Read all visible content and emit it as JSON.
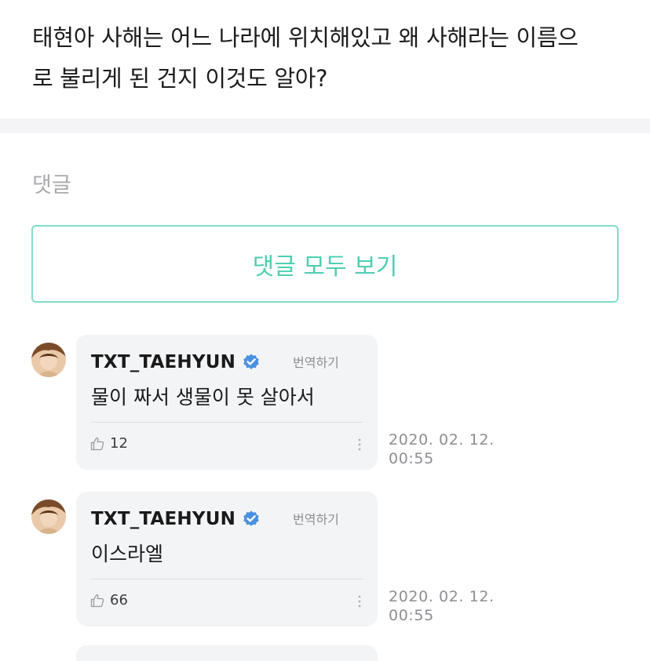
{
  "post": {
    "text_line1": "태현아 사해는 어느 나라에 위치해있고 왜 사해라는 이름으",
    "text_line2": "로 불리게 된 건지 이것도 알아?"
  },
  "comments_section": {
    "heading": "댓글",
    "view_all_label": "댓글 모두 보기"
  },
  "comments": [
    {
      "author": "TXT_TAEHYUN",
      "translate_label": "번역하기",
      "text": "물이 짜서 생물이 못 살아서",
      "likes": "12",
      "date": "2020. 02. 12.",
      "time": "00:55"
    },
    {
      "author": "TXT_TAEHYUN",
      "translate_label": "번역하기",
      "text": "이스라엘",
      "likes": "66",
      "date": "2020. 02. 12.",
      "time": "00:55"
    }
  ],
  "icons": {
    "verified": "verified-badge-icon",
    "like": "thumbs-up-icon",
    "more": "more-vertical-icon"
  },
  "colors": {
    "accent": "#4fcfb2",
    "accent_border": "#7fddc9",
    "bubble_bg": "#f3f4f6",
    "verified_blue": "#4a90e2",
    "muted_text": "#8e8e93"
  }
}
